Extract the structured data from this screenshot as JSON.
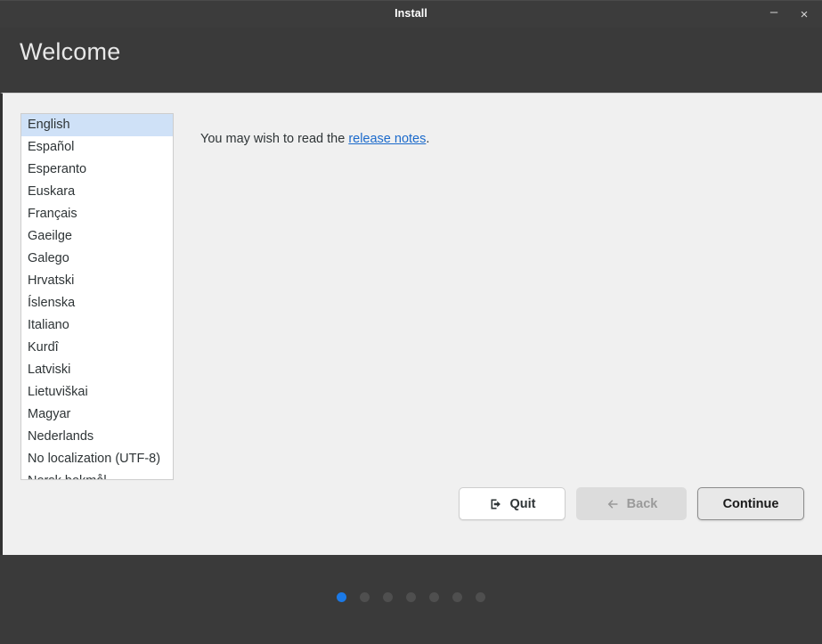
{
  "titlebar": {
    "title": "Install",
    "minimize_label": "–",
    "close_label": "×"
  },
  "header": {
    "page_title": "Welcome"
  },
  "language_list": {
    "selected": "English",
    "items": [
      "English",
      "Español",
      "Esperanto",
      "Euskara",
      "Français",
      "Gaeilge",
      "Galego",
      "Hrvatski",
      "Íslenska",
      "Italiano",
      "Kurdî",
      "Latviski",
      "Lietuviškai",
      "Magyar",
      "Nederlands",
      "No localization (UTF-8)",
      "Norsk bokmål"
    ]
  },
  "content": {
    "text_before_link": "You may wish to read the ",
    "link_label": "release notes",
    "text_after_link": "."
  },
  "buttons": {
    "quit": "Quit",
    "back": "Back",
    "continue": "Continue"
  },
  "progress": {
    "total_steps": 7,
    "current_step": 1
  },
  "colors": {
    "accent": "#1b79e6",
    "link": "#1b6acb",
    "selection": "#cfe1f7",
    "panel_bg": "#f0f0f0",
    "chrome_bg": "#3a3a3a"
  }
}
